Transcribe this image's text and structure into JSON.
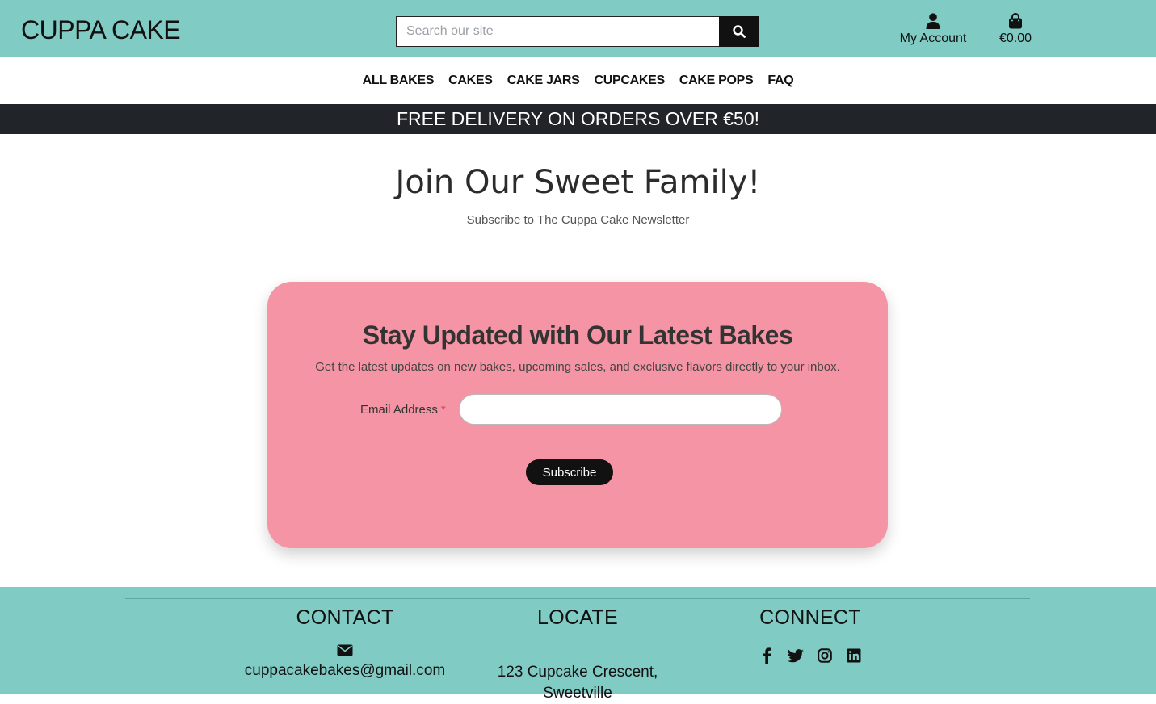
{
  "header": {
    "logo": "CUPPA CAKE",
    "search_placeholder": "Search our site",
    "account_label": "My Account",
    "bag_total": "€0.00"
  },
  "nav": {
    "items": [
      "ALL BAKES",
      "CAKES",
      "CAKE JARS",
      "CUPCAKES",
      "CAKE POPS",
      "FAQ"
    ]
  },
  "banner": {
    "text": "FREE DELIVERY ON ORDERS OVER €50!"
  },
  "hero": {
    "title": "Join Our Sweet Family!",
    "subtitle": "Subscribe to The Cuppa Cake Newsletter"
  },
  "newsletter": {
    "title": "Stay Updated with Our Latest Bakes",
    "description": "Get the latest updates on new bakes, upcoming sales, and exclusive flavors directly to your inbox.",
    "email_label": "Email Address",
    "required_mark": "*",
    "email_value": "",
    "submit_label": "Subscribe"
  },
  "footer": {
    "contact_heading": "CONTACT",
    "contact_email": "cuppacakebakes@gmail.com",
    "locate_heading": "LOCATE",
    "address_line1": "123 Cupcake Crescent,",
    "address_line2": "Sweetville",
    "connect_heading": "CONNECT",
    "socials": [
      "facebook-icon",
      "twitter-icon",
      "instagram-icon",
      "linkedin-icon"
    ]
  },
  "colors": {
    "teal": "#80cbc4",
    "pink": "#f594a4",
    "dark": "#212529"
  }
}
